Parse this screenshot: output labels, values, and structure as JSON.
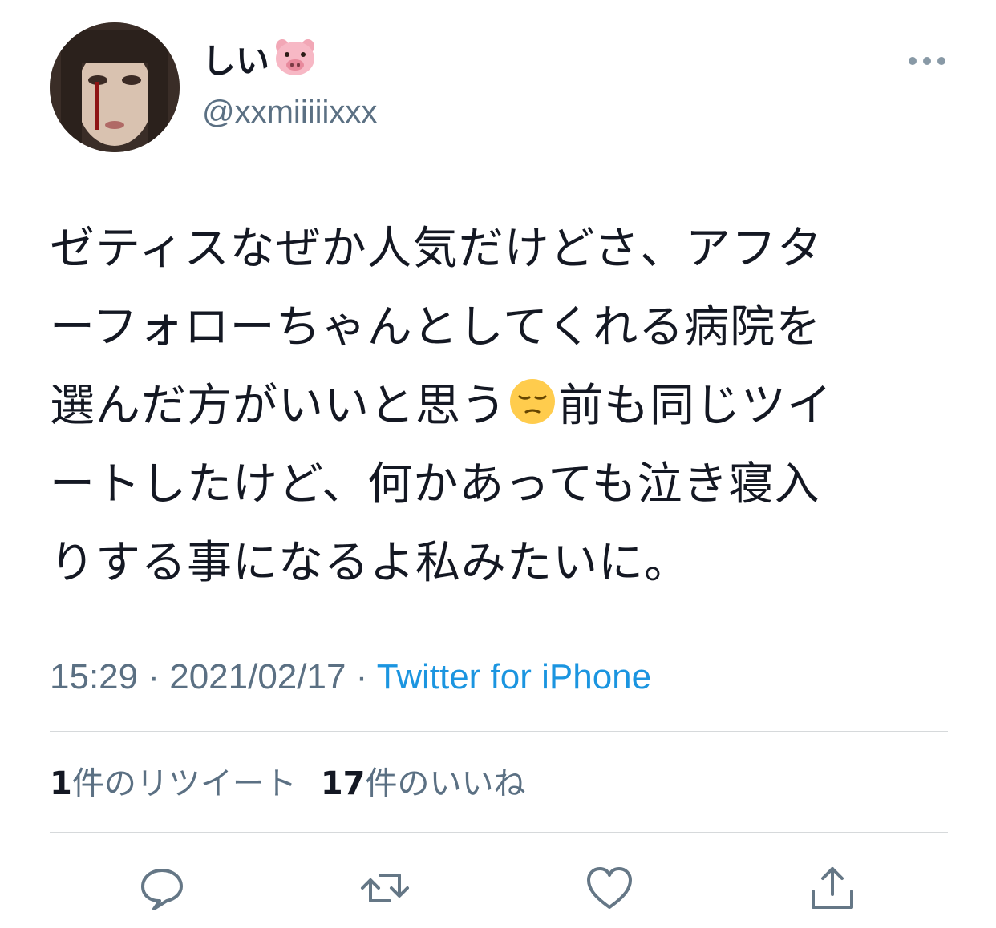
{
  "user": {
    "display_name": "しい",
    "name_emoji": "pig-face-emoji",
    "handle": "@xxmiiiiixxx"
  },
  "tweet": {
    "lines": [
      "ゼティスなぜか人気だけどさ、アフタ",
      "ーフォローちゃんとしてくれる病院を",
      "選んだ方がいいと思う",
      "前も同じツイ",
      "ートしたけど、何かあっても泣き寝入",
      "りする事になるよ私みたいに。"
    ],
    "inline_emoji": "pensive-face-emoji"
  },
  "meta": {
    "time": "15:29",
    "sep1": " · ",
    "date": "2021/02/17",
    "sep2": " · ",
    "source": "Twitter for iPhone"
  },
  "stats": {
    "retweets_count": "1",
    "retweets_label": "件のリツイート",
    "likes_count": "17",
    "likes_label": "件のいいね"
  },
  "actions": {
    "reply_icon": "reply-icon",
    "retweet_icon": "retweet-icon",
    "like_icon": "heart-icon",
    "share_icon": "share-icon"
  },
  "colors": {
    "text": "#141823",
    "secondary": "#5b7083",
    "link": "#1b95e0",
    "divider": "#d6d9db"
  }
}
